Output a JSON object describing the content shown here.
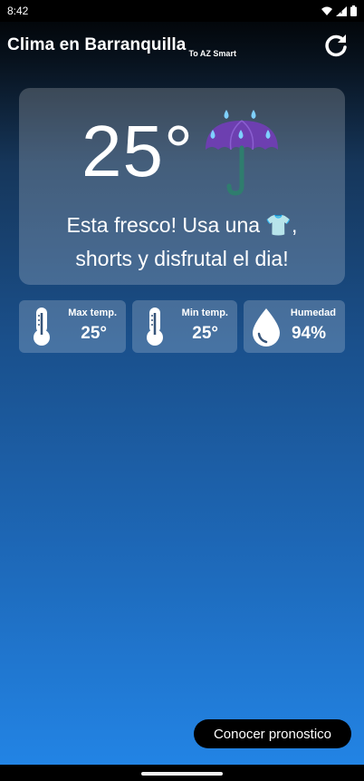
{
  "status_bar": {
    "time": "8:42",
    "icons": [
      "wifi-icon",
      "signal-icon",
      "battery-icon"
    ]
  },
  "header": {
    "title": "Clima en Barranquilla",
    "subtitle": "To AZ Smart",
    "refresh_icon": "refresh-icon"
  },
  "weather": {
    "temperature": "25°",
    "icon": "umbrella-rain-icon",
    "message": "Esta fresco! Usa una 👕, shorts y disfrutal el dia!"
  },
  "stats": [
    {
      "label": "Max temp.",
      "value": "25°",
      "icon": "thermometer-icon"
    },
    {
      "label": "Min temp.",
      "value": "25°",
      "icon": "thermometer-icon"
    },
    {
      "label": "Humedad",
      "value": "94%",
      "icon": "water-drop-icon"
    }
  ],
  "actions": {
    "forecast_label": "Conocer pronostico"
  },
  "colors": {
    "background_top": "#000000",
    "background_bottom": "#2386e8",
    "card": "rgba(255,255,255,0.20)",
    "button": "#000000"
  }
}
